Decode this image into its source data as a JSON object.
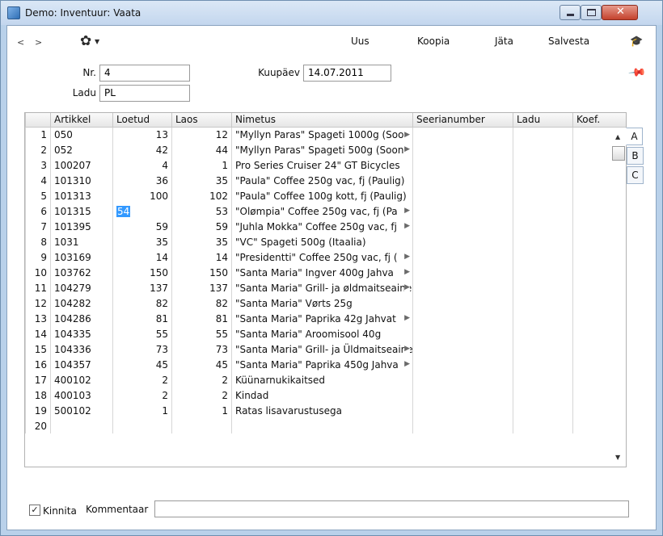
{
  "window": {
    "title": "Demo: Inventuur: Vaata",
    "close_glyph": "✕"
  },
  "toolbar": {
    "back": "<",
    "forward": ">",
    "gear_glyph": "✿",
    "caret": "▼",
    "buttons": [
      "Uus",
      "Koopia",
      "Jäta",
      "Salvesta"
    ],
    "help_glyph": "🎓"
  },
  "header": {
    "nr_label": "Nr.",
    "nr_value": "4",
    "ladu_label": "Ladu",
    "ladu_value": "PL",
    "date_label": "Kuupäev",
    "date_value": "14.07.2011",
    "pin_glyph": "📌"
  },
  "grid": {
    "columns": [
      "",
      "Artikkel",
      "Loetud",
      "Laos",
      "Nimetus",
      "Seerianumber",
      "Ladu",
      "Koef."
    ],
    "more_glyph": "▶",
    "rows": [
      {
        "n": "1",
        "art": "050",
        "loe": "13",
        "lao": "12",
        "nim": "\"Myllyn Paras\" Spageti 1000g  (Soo",
        "more": true
      },
      {
        "n": "2",
        "art": "052",
        "loe": "42",
        "lao": "44",
        "nim": "\"Myllyn Paras\" Spageti 500g  (Soon",
        "more": true
      },
      {
        "n": "3",
        "art": "100207",
        "loe": "4",
        "lao": "1",
        "nim": "Pro Series Cruiser 24\"  GT Bicycles",
        "more": false
      },
      {
        "n": "4",
        "art": "101310",
        "loe": "36",
        "lao": "35",
        "nim": "\"Paula\" Coffee 250g vac, fj  (Paulig)",
        "more": false
      },
      {
        "n": "5",
        "art": "101313",
        "loe": "100",
        "lao": "102",
        "nim": "\"Paula\" Coffee 100g kott, fj  (Paulig)",
        "more": false
      },
      {
        "n": "6",
        "art": "101315",
        "loe": "54",
        "lao": "53",
        "nim": "\"Olømpia\" Coffee 250g vac, fj  (Pa",
        "more": true,
        "selected": true
      },
      {
        "n": "7",
        "art": "101395",
        "loe": "59",
        "lao": "59",
        "nim": "\"Juhla Mokka\" Coffee 250g vac, fj",
        "more": true
      },
      {
        "n": "8",
        "art": "1031",
        "loe": "35",
        "lao": "35",
        "nim": "\"VC\" Spageti    500g  (Itaalia)",
        "more": false
      },
      {
        "n": "9",
        "art": "103169",
        "loe": "14",
        "lao": "14",
        "nim": "\"Presidentti\" Coffee 250g vac, fj  (",
        "more": true
      },
      {
        "n": "10",
        "art": "103762",
        "loe": "150",
        "lao": "150",
        "nim": "\"Santa Maria\" Ingver  400g  Jahva",
        "more": true
      },
      {
        "n": "11",
        "art": "104279",
        "loe": "137",
        "lao": "137",
        "nim": "\"Santa Maria\" Grill- ja øldmaitseaine",
        "more": true
      },
      {
        "n": "12",
        "art": "104282",
        "loe": "82",
        "lao": "82",
        "nim": "\"Santa Maria\" Vørts  25g",
        "more": false
      },
      {
        "n": "13",
        "art": "104286",
        "loe": "81",
        "lao": "81",
        "nim": "\"Santa Maria\" Paprika  42g  Jahvat",
        "more": true
      },
      {
        "n": "14",
        "art": "104335",
        "loe": "55",
        "lao": "55",
        "nim": "\"Santa Maria\" Aroomisool  40g",
        "more": false
      },
      {
        "n": "15",
        "art": "104336",
        "loe": "73",
        "lao": "73",
        "nim": "\"Santa Maria\" Grill- ja Üldmaitseaine",
        "more": true
      },
      {
        "n": "16",
        "art": "104357",
        "loe": "45",
        "lao": "45",
        "nim": "\"Santa Maria\" Paprika  450g  Jahva",
        "more": true
      },
      {
        "n": "17",
        "art": "400102",
        "loe": "2",
        "lao": "2",
        "nim": "Küünarnukikaitsed",
        "more": false
      },
      {
        "n": "18",
        "art": "400103",
        "loe": "2",
        "lao": "2",
        "nim": "Kindad",
        "more": false
      },
      {
        "n": "19",
        "art": "500102",
        "loe": "1",
        "lao": "1",
        "nim": "Ratas lisavarustusega",
        "more": false
      },
      {
        "n": "20",
        "art": "",
        "loe": "",
        "lao": "",
        "nim": "",
        "more": false
      }
    ],
    "scroll_up": "▲",
    "scroll_down": "▼"
  },
  "tabs": [
    "A",
    "B",
    "C"
  ],
  "footer": {
    "checkbox_checked": true,
    "checkbox_glyph": "✓",
    "checkbox_label": "Kinnita",
    "comment_label": "Kommentaar",
    "comment_value": ""
  }
}
